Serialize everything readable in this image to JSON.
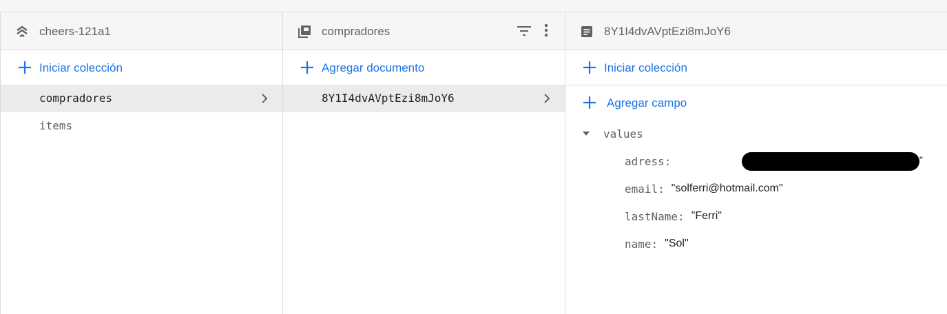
{
  "root_panel": {
    "title": "cheers-121a1",
    "icon": "firestore-stack-icon",
    "add_label": "Iniciar colección",
    "items": [
      {
        "label": "compradores",
        "selected": true
      },
      {
        "label": "items",
        "selected": false
      }
    ]
  },
  "collection_panel": {
    "title": "compradores",
    "icon": "collection-icon",
    "add_label": "Agregar documento",
    "items": [
      {
        "label": "8Y1I4dvAVptEzi8mJoY6",
        "selected": true
      }
    ]
  },
  "document_panel": {
    "title": "8Y1I4dvAVptEzi8mJoY6",
    "icon": "document-icon",
    "add_collection_label": "Iniciar colección",
    "add_field_label": "Agregar campo",
    "map_field": {
      "name": "values",
      "fields": [
        {
          "key": "adress:",
          "value": "\"",
          "redacted": true
        },
        {
          "key": "email:",
          "value": "\"solferri@hotmail.com\""
        },
        {
          "key": "lastName:",
          "value": "\"Ferri\""
        },
        {
          "key": "name:",
          "value": "\"Sol\""
        }
      ]
    }
  },
  "colors": {
    "accent": "#1a73e8",
    "header_bg": "#f6f6f6",
    "selected_bg": "#ebebeb",
    "border": "#dadce0",
    "muted_text": "#5f6368"
  }
}
